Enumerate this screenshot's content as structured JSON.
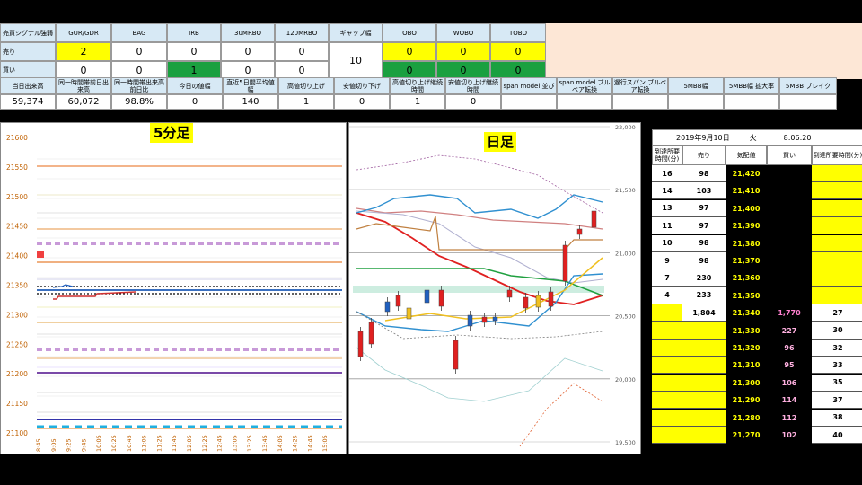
{
  "signal_table": {
    "corner": "売買シグナル強弱",
    "columns": [
      "GUR/GDR",
      "BAG",
      "IRB",
      "30MRBO",
      "120MRBO",
      "ギャップ幅",
      "OBO",
      "WOBO",
      "TOBO"
    ],
    "rows": [
      {
        "label": "売り",
        "values": [
          "2",
          "0",
          "0",
          "0",
          "0",
          "",
          "0",
          "0",
          "0"
        ]
      },
      {
        "label": "買い",
        "values": [
          "0",
          "0",
          "1",
          "0",
          "0",
          "",
          "0",
          "0",
          "0"
        ]
      }
    ],
    "gap_value": "10"
  },
  "stats_table": {
    "headers": [
      "当日出来高",
      "同一時間帯前日出来高",
      "同一時間帯出来高前日比",
      "今日の値幅",
      "直近5日間平均値幅",
      "高値切り上げ",
      "安値切り下げ",
      "高値切り上げ継続時間",
      "安値切り上げ継続時間",
      "span model 並び",
      "span model ブルベア転換",
      "遅行スパン ブルベア転換",
      "5MBB幅",
      "5MBB幅 拡大率",
      "5MBB ブレイク"
    ],
    "values": [
      "59,374",
      "60,072",
      "98.8%",
      "0",
      "140",
      "1",
      "0",
      "1",
      "0",
      "",
      "",
      "",
      "",
      "",
      ""
    ]
  },
  "chart5": {
    "title": "5分足",
    "y_ticks": [
      "21600",
      "21550",
      "21500",
      "21450",
      "21400",
      "21350",
      "21300",
      "21250",
      "21200",
      "21150",
      "21100"
    ],
    "x_ticks": [
      "8:45",
      "9:05",
      "9:25",
      "9:45",
      "10:05",
      "10:25",
      "10:45",
      "11:05",
      "11:25",
      "11:45",
      "12:05",
      "12:25",
      "12:45",
      "13:05",
      "13:25",
      "13:45",
      "14:05",
      "14:25",
      "14:45",
      "15:05"
    ]
  },
  "chart_daily": {
    "title": "日足",
    "y_ticks": [
      "22,000",
      "21,500",
      "21,000",
      "20,500",
      "20,000",
      "19,500"
    ]
  },
  "order_book": {
    "date": "2019年9月10日",
    "weekday": "火",
    "time": "8:06:20",
    "headers": [
      "到達所要時間(分)",
      "売り",
      "気配値",
      "買い",
      "到達所要時間(分)"
    ],
    "rows": [
      {
        "t_sell": "16",
        "sell": "98",
        "price": "21,420",
        "buy": "",
        "t_buy": ""
      },
      {
        "t_sell": "14",
        "sell": "103",
        "price": "21,410",
        "buy": "",
        "t_buy": ""
      },
      {
        "t_sell": "13",
        "sell": "97",
        "price": "21,400",
        "buy": "",
        "t_buy": ""
      },
      {
        "t_sell": "11",
        "sell": "97",
        "price": "21,390",
        "buy": "",
        "t_buy": ""
      },
      {
        "t_sell": "10",
        "sell": "98",
        "price": "21,380",
        "buy": "",
        "t_buy": ""
      },
      {
        "t_sell": "9",
        "sell": "98",
        "price": "21,370",
        "buy": "",
        "t_buy": ""
      },
      {
        "t_sell": "7",
        "sell": "230",
        "price": "21,360",
        "buy": "",
        "t_buy": ""
      },
      {
        "t_sell": "4",
        "sell": "233",
        "price": "21,350",
        "buy": "",
        "t_buy": ""
      },
      {
        "t_sell": "",
        "sell": "1,804",
        "price": "21,340",
        "buy": "1,770",
        "t_buy": "27"
      },
      {
        "t_sell": "",
        "sell": "",
        "price": "21,330",
        "buy": "227",
        "t_buy": "30"
      },
      {
        "t_sell": "",
        "sell": "",
        "price": "21,320",
        "buy": "96",
        "t_buy": "32"
      },
      {
        "t_sell": "",
        "sell": "",
        "price": "21,310",
        "buy": "95",
        "t_buy": "33"
      },
      {
        "t_sell": "",
        "sell": "",
        "price": "21,300",
        "buy": "106",
        "t_buy": "35"
      },
      {
        "t_sell": "",
        "sell": "",
        "price": "21,290",
        "buy": "114",
        "t_buy": "37"
      },
      {
        "t_sell": "",
        "sell": "",
        "price": "21,280",
        "buy": "112",
        "t_buy": "38"
      },
      {
        "t_sell": "",
        "sell": "",
        "price": "21,270",
        "buy": "102",
        "t_buy": "40"
      }
    ]
  },
  "colors": {
    "yellow": "#ffff00",
    "green": "#1aa040",
    "header_blue": "#d7e9f5"
  }
}
